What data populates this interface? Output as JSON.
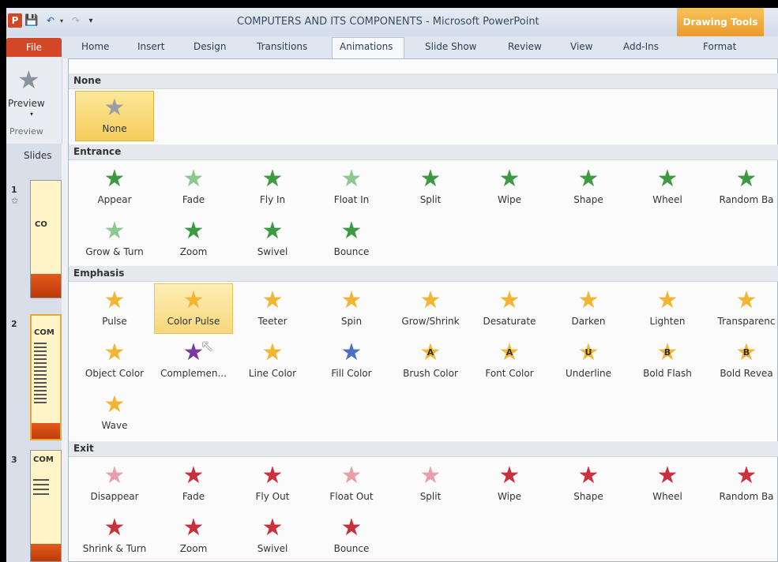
{
  "title_bar": {
    "app_icon": "P",
    "save_icon": "save-icon",
    "window_title": "COMPUTERS AND ITS COMPONENTS  -  Microsoft PowerPoint",
    "contextual_tab": "Drawing Tools"
  },
  "tabs": {
    "file": "File",
    "home": "Home",
    "insert": "Insert",
    "design": "Design",
    "transitions": "Transitions",
    "animations": "Animations",
    "slide_show": "Slide Show",
    "review": "Review",
    "view": "View",
    "addins": "Add-Ins",
    "format": "Format"
  },
  "preview_group": {
    "button_label": "Preview",
    "group_label": "Preview"
  },
  "slides_pane": {
    "tab_label": "Slides",
    "slides": [
      {
        "number": "1",
        "text": "CO"
      },
      {
        "number": "2",
        "text": "COM"
      },
      {
        "number": "3",
        "text": "COM"
      }
    ]
  },
  "gallery": {
    "none_section": "None",
    "none_item": "None",
    "entrance_section": "Entrance",
    "entrance_items": [
      "Appear",
      "Fade",
      "Fly In",
      "Float In",
      "Split",
      "Wipe",
      "Shape",
      "Wheel",
      "Random Ba",
      "Grow & Turn",
      "Zoom",
      "Swivel",
      "Bounce"
    ],
    "emphasis_section": "Emphasis",
    "emphasis_items": [
      "Pulse",
      "Color Pulse",
      "Teeter",
      "Spin",
      "Grow/Shrink",
      "Desaturate",
      "Darken",
      "Lighten",
      "Transparenc",
      "Object Color",
      "Complemen...",
      "Line Color",
      "Fill Color",
      "Brush Color",
      "Font Color",
      "Underline",
      "Bold Flash",
      "Bold Revea",
      "Wave"
    ],
    "exit_section": "Exit",
    "exit_items": [
      "Disappear",
      "Fade",
      "Fly Out",
      "Float Out",
      "Split",
      "Wipe",
      "Shape",
      "Wheel",
      "Random Ba",
      "Shrink & Turn",
      "Zoom",
      "Swivel",
      "Bounce"
    ],
    "selected_item": "None",
    "hovered_item": "Color Pulse",
    "overlay_letters": {
      "brush": "A",
      "font": "A",
      "underline": "U",
      "bold_flash": "B",
      "bold_reveal": "B"
    }
  },
  "colors": {
    "file_tab": "#d24726",
    "drawing_tools": "#f0a83a",
    "entrance_star": "#3d9a42",
    "emphasis_star": "#f3b431",
    "exit_star": "#c8313d"
  }
}
